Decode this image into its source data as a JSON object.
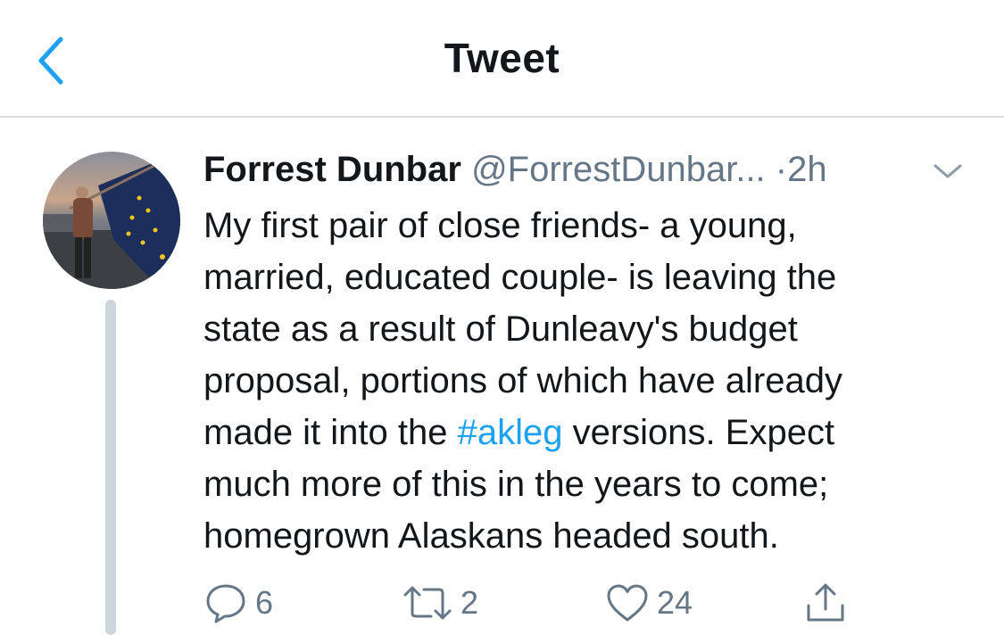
{
  "header": {
    "title": "Tweet"
  },
  "tweet": {
    "author_name": "Forrest Dunbar",
    "handle": "@ForrestDunbar...",
    "separator": "·",
    "time": "2h",
    "lines": [
      "My first pair of close friends- a young,",
      "married, educated couple- is leaving the",
      "state as a result of Dunleavy's budget",
      "proposal, portions of which have already"
    ],
    "line5_before": "made it into the ",
    "hashtag": "#akleg",
    "line5_after": " versions. Expect",
    "lines_end": [
      "much more of this in the years to come;",
      "homegrown Alaskans headed south."
    ]
  },
  "actions": {
    "reply_count": "6",
    "retweet_count": "2",
    "like_count": "24"
  },
  "icons": {
    "back": "chevron-left-icon",
    "caret": "chevron-down-icon",
    "reply": "reply-icon",
    "retweet": "retweet-icon",
    "like": "heart-icon",
    "share": "share-icon"
  },
  "colors": {
    "accent": "#1da1f2",
    "muted": "#657786",
    "text": "#14171a",
    "divider": "#d9dde1",
    "thread_line": "#ccd6dd"
  }
}
